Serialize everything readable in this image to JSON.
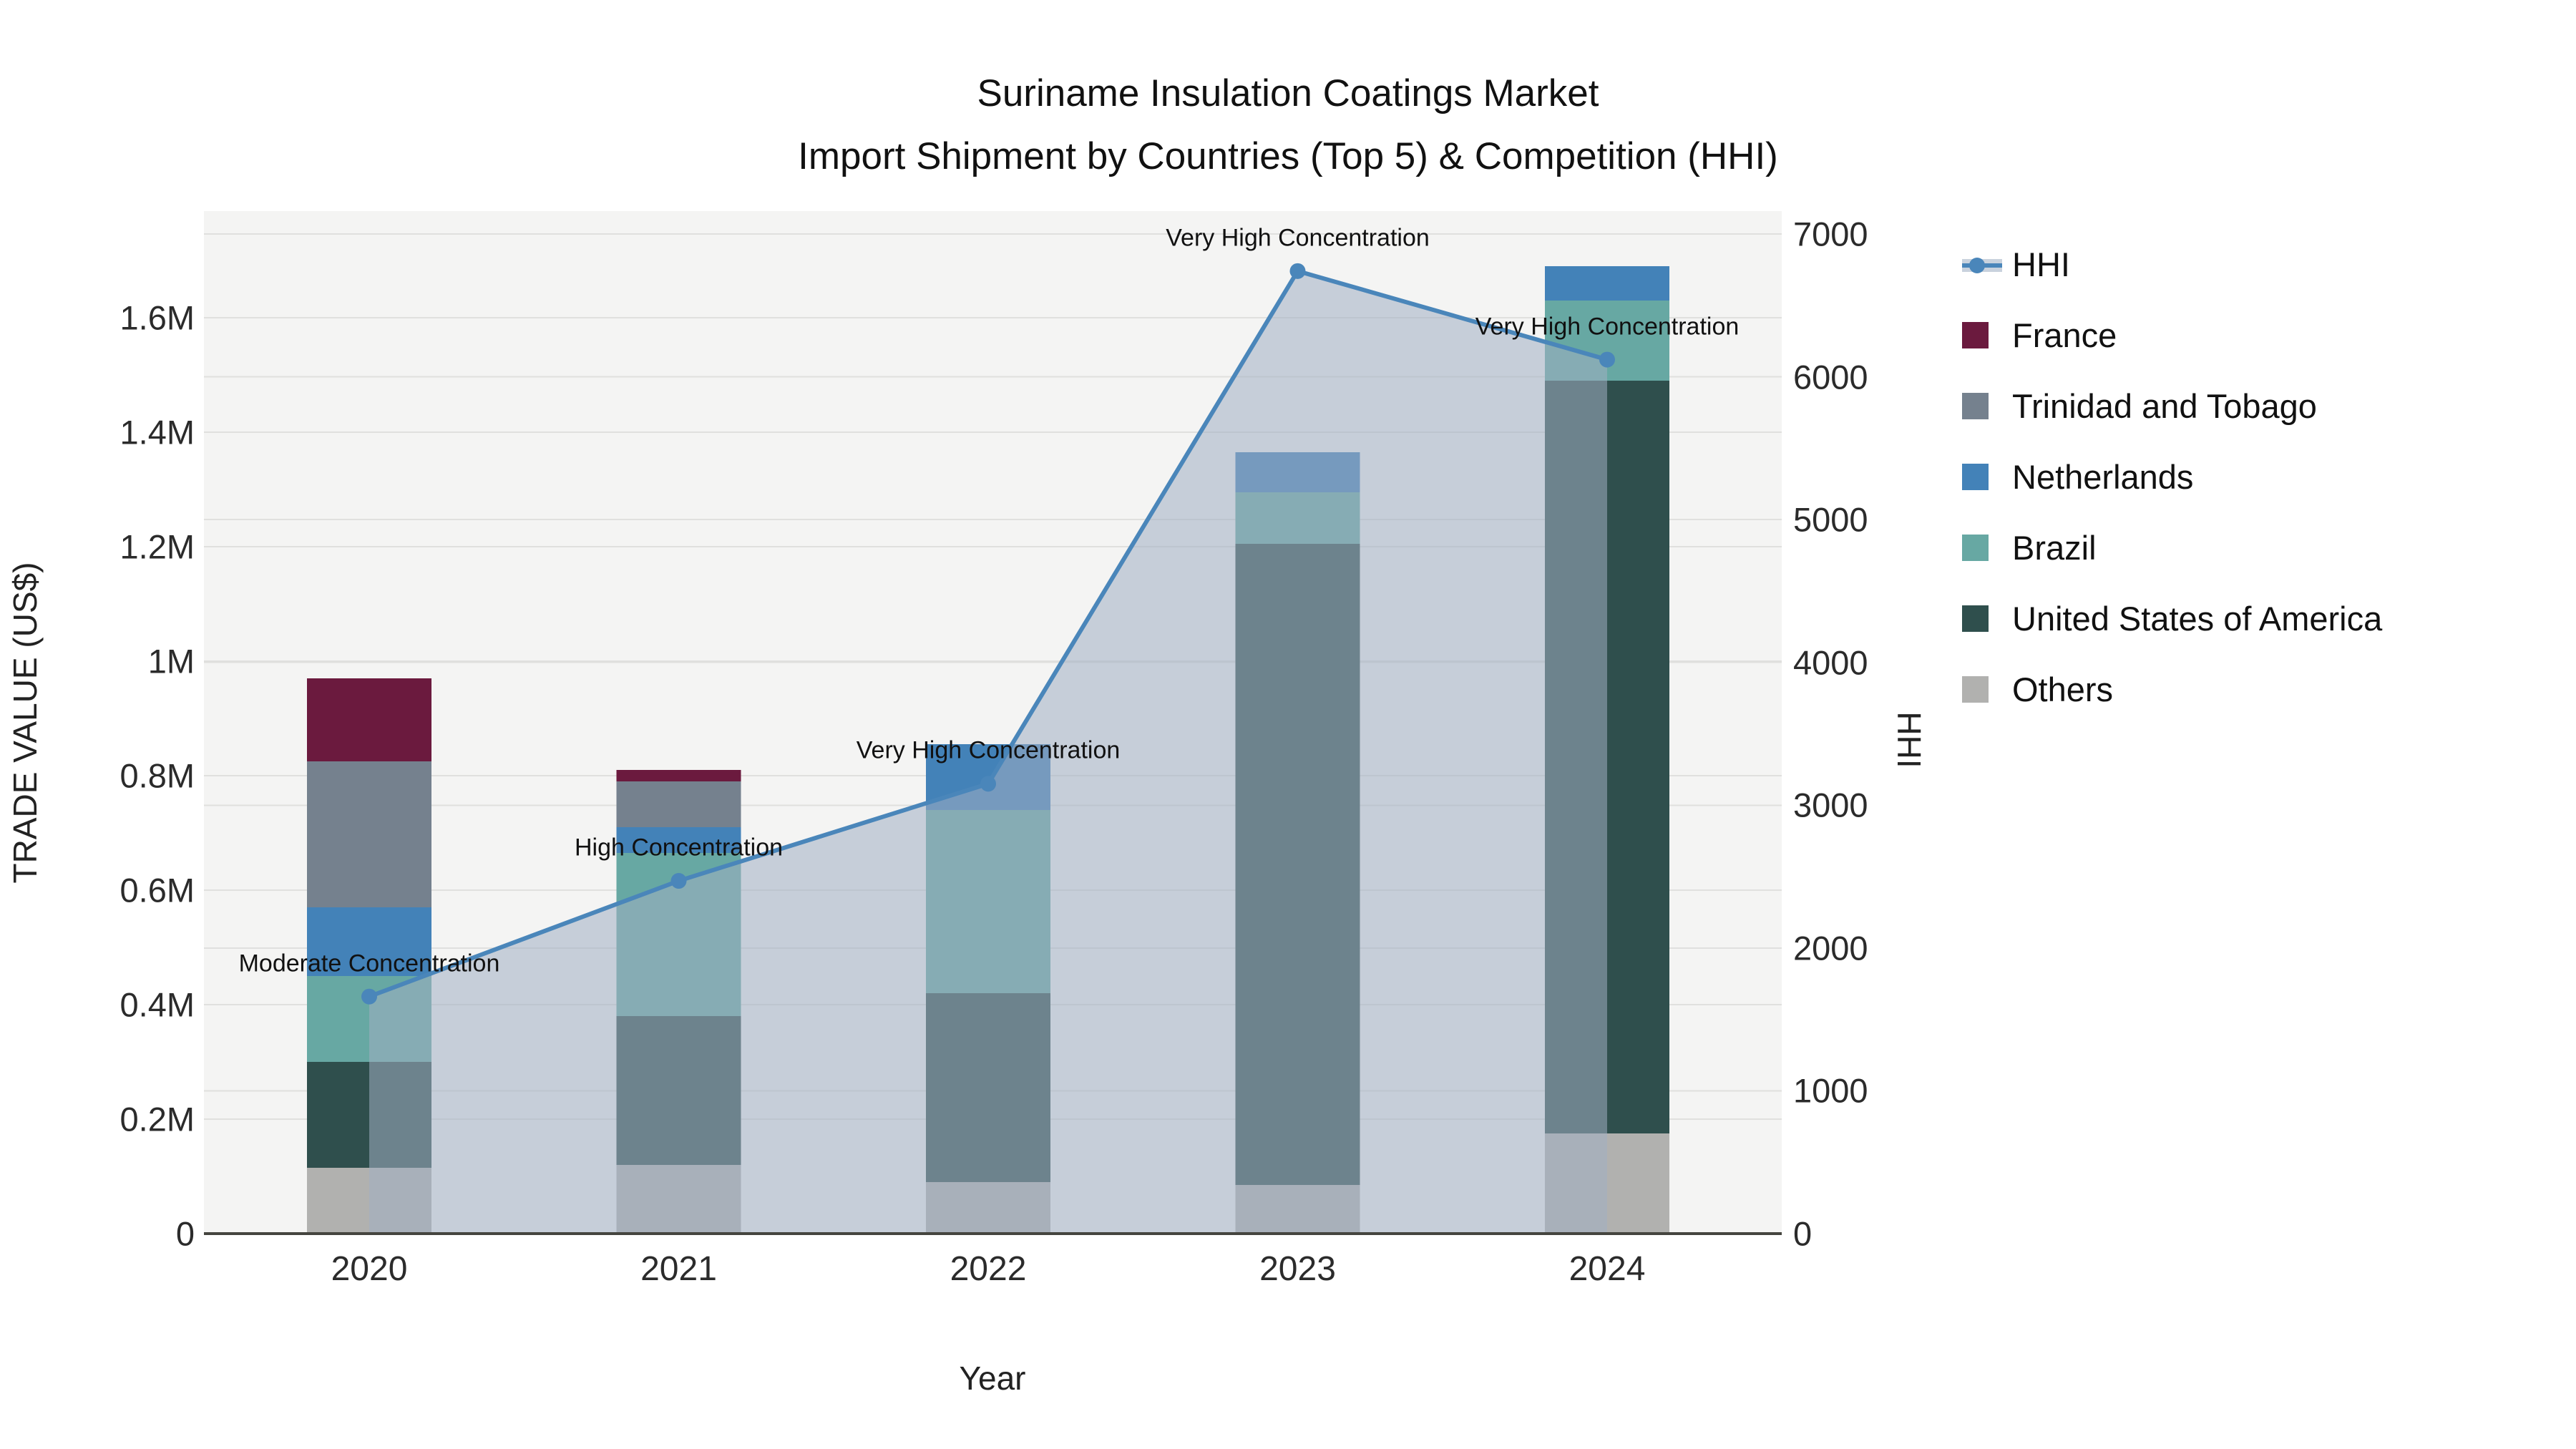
{
  "title": {
    "line1": "Suriname Insulation Coatings Market",
    "line2": "Import Shipment by Countries (Top 5) & Competition (HHI)"
  },
  "chart_data": {
    "type": "bar",
    "subtype": "stacked-bars-with-line-area",
    "categories": [
      "2020",
      "2021",
      "2022",
      "2023",
      "2024"
    ],
    "series": [
      {
        "name": "Others",
        "color": "#b1b1af",
        "values": [
          115000,
          120000,
          90000,
          85000,
          175000
        ]
      },
      {
        "name": "United States of America",
        "color": "#2f4f4d",
        "values": [
          185000,
          260000,
          330000,
          1120000,
          1315000
        ]
      },
      {
        "name": "Brazil",
        "color": "#67a8a3",
        "values": [
          150000,
          285000,
          320000,
          90000,
          140000
        ]
      },
      {
        "name": "Netherlands",
        "color": "#4382b8",
        "values": [
          120000,
          45000,
          115000,
          70000,
          60000
        ]
      },
      {
        "name": "Trinidad and Tobago",
        "color": "#75818e",
        "values": [
          255000,
          80000,
          0,
          0,
          0
        ]
      },
      {
        "name": "France",
        "color": "#6b1a3e",
        "values": [
          145000,
          20000,
          0,
          0,
          0
        ]
      }
    ],
    "hhi": {
      "name": "HHI",
      "line_color": "#4a86ba",
      "area_color": "rgba(160,174,194,0.55)",
      "values": [
        1660,
        2470,
        3150,
        6740,
        6120
      ],
      "annotations": [
        "Moderate Concentration",
        "High Concentration",
        "Very High Concentration",
        "Very High Concentration",
        "Very High Concentration"
      ]
    },
    "left_axis": {
      "label": "TRADE VALUE (US$)",
      "ticks": [
        {
          "v": 0,
          "label": "0"
        },
        {
          "v": 200000,
          "label": "0.2M"
        },
        {
          "v": 400000,
          "label": "0.4M"
        },
        {
          "v": 600000,
          "label": "0.6M"
        },
        {
          "v": 800000,
          "label": "0.8M"
        },
        {
          "v": 1000000,
          "label": "1M"
        },
        {
          "v": 1200000,
          "label": "1.2M"
        },
        {
          "v": 1400000,
          "label": "1.4M"
        },
        {
          "v": 1600000,
          "label": "1.6M"
        }
      ],
      "range": [
        0,
        1786250
      ]
    },
    "right_axis": {
      "label": "HHI",
      "ticks": [
        {
          "v": 0,
          "label": "0"
        },
        {
          "v": 1000,
          "label": "1000"
        },
        {
          "v": 2000,
          "label": "2000"
        },
        {
          "v": 3000,
          "label": "3000"
        },
        {
          "v": 4000,
          "label": "4000"
        },
        {
          "v": 5000,
          "label": "5000"
        },
        {
          "v": 6000,
          "label": "6000"
        },
        {
          "v": 7000,
          "label": "7000"
        }
      ],
      "range": [
        0,
        7160
      ]
    },
    "xlabel": "Year",
    "grid": true,
    "legend_position": "right",
    "legend": [
      "HHI",
      "France",
      "Trinidad and Tobago",
      "Netherlands",
      "Brazil",
      "United States of America",
      "Others"
    ],
    "colors": {
      "plot_background": "#f4f4f3",
      "gridline": "#e0e0de",
      "axis_line": "#45453f"
    }
  }
}
